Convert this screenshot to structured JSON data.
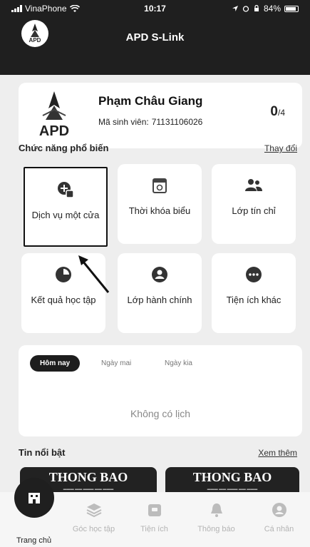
{
  "status_bar": {
    "carrier": "VinaPhone",
    "time": "10:17",
    "battery": "84%"
  },
  "header": {
    "title": "APD S-Link",
    "logo_text": "APD"
  },
  "profile": {
    "name": "Phạm Châu Giang",
    "student_id_label": "Mã sinh viên:",
    "student_id": "71131106026",
    "count": "0",
    "count_total": "/4",
    "logo_text": "APD"
  },
  "features": {
    "title": "Chức năng phổ biến",
    "change_label": "Thay đổi",
    "items": [
      {
        "label": "Dịch vụ một cửa",
        "icon": "service-icon"
      },
      {
        "label": "Thời khóa biểu",
        "icon": "calendar-icon"
      },
      {
        "label": "Lớp tín chỉ",
        "icon": "users-icon"
      },
      {
        "label": "Kết quả học tập",
        "icon": "pie-chart-icon"
      },
      {
        "label": "Lớp hành chính",
        "icon": "user-circle-icon"
      },
      {
        "label": "Tiện ích khác",
        "icon": "more-icon"
      }
    ]
  },
  "schedule": {
    "tabs": [
      "Hôm nay",
      "Ngày mai",
      "Ngày kia"
    ],
    "active_tab": "Hôm nay",
    "empty_message": "Không có lịch"
  },
  "news": {
    "title": "Tin nổi bật",
    "see_more": "Xem thêm",
    "items": [
      {
        "title": "THONG BAO"
      },
      {
        "title": "THONG BAO"
      }
    ]
  },
  "bottom_nav": {
    "items": [
      {
        "label": "Trang chủ",
        "icon": "home-icon"
      },
      {
        "label": "Góc học tập",
        "icon": "layers-icon"
      },
      {
        "label": "Tiện ích",
        "icon": "box-icon"
      },
      {
        "label": "Thông báo",
        "icon": "bell-icon"
      },
      {
        "label": "Cá nhân",
        "icon": "person-icon"
      }
    ],
    "active": "Trang chủ"
  },
  "colors": {
    "header_bg": "#1f1f1f",
    "page_bg": "#eeeeee",
    "card_bg": "#ffffff",
    "active_dark": "#1d1d1d",
    "inactive_gray": "#b4b4b4"
  }
}
